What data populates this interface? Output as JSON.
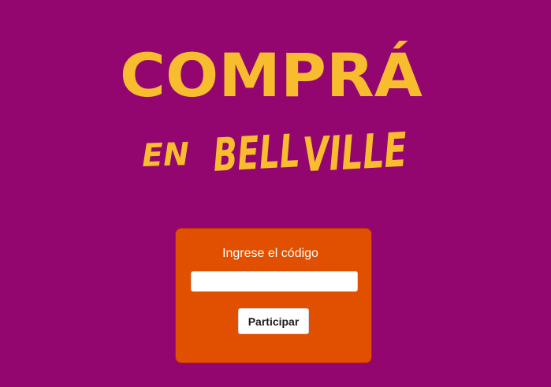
{
  "logo": {
    "line1": "COMPRÁ",
    "line2_en": "EN",
    "line2_bell": "BELL",
    "line2_ville": "VILLE",
    "color": "#f7bd2e"
  },
  "form": {
    "label": "Ingrese el código",
    "code_value": "",
    "code_placeholder": "",
    "submit_label": "Participar"
  },
  "colors": {
    "background": "#930670",
    "card": "#e05000",
    "accent": "#f7bd2e"
  }
}
